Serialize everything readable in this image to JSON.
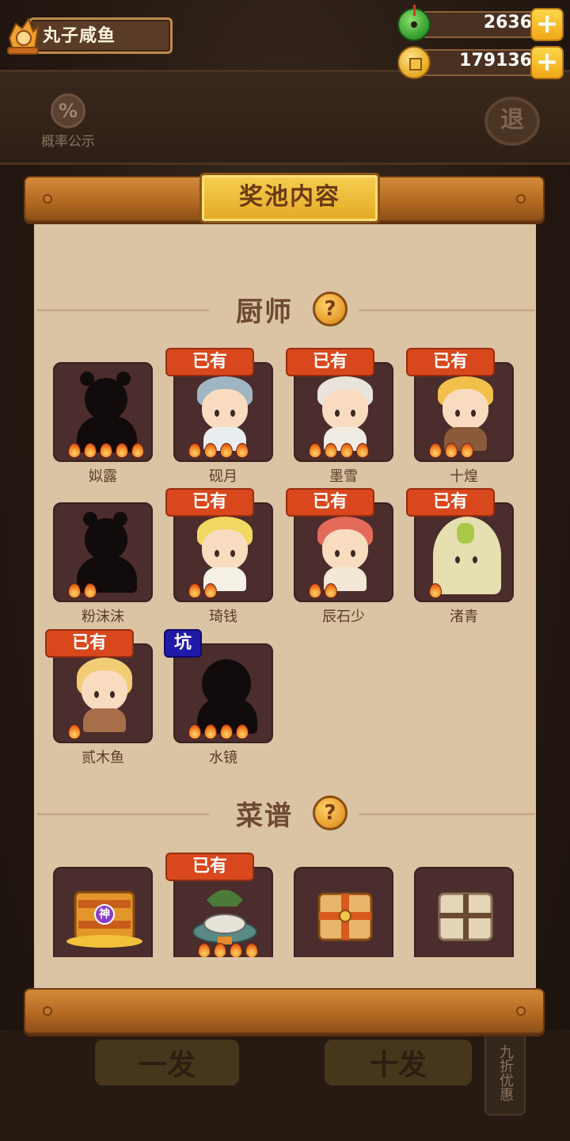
{
  "player": {
    "name": "丸子咸鱼"
  },
  "currencies": [
    {
      "icon": "jade-icon",
      "value": "2636"
    },
    {
      "icon": "coin-icon",
      "value": "179136"
    }
  ],
  "background": {
    "probability_label": "概率公示",
    "probability_symbol": "%",
    "back_label": "退",
    "draw_one_label": "一发",
    "draw_ten_label": "十发",
    "discount_label": "九折优惠"
  },
  "panel": {
    "title": "奖池内容"
  },
  "chef_section": {
    "title": "厨师",
    "help_symbol": "?",
    "owned_label": "已有",
    "pit_label": "坑",
    "chefs": [
      {
        "name": "姒露",
        "owned": false,
        "flames": 5,
        "hidden": true
      },
      {
        "name": "砚月",
        "owned": true,
        "flames": 4
      },
      {
        "name": "墨雪",
        "owned": true,
        "flames": 4
      },
      {
        "name": "十煌",
        "owned": true,
        "flames": 3
      },
      {
        "name": "粉沫沫",
        "owned": false,
        "flames": 2,
        "hidden": true
      },
      {
        "name": "琦钱",
        "owned": true,
        "flames": 2
      },
      {
        "name": "辰石少",
        "owned": true,
        "flames": 2
      },
      {
        "name": "渚青",
        "owned": true,
        "flames": 1
      },
      {
        "name": "贰木鱼",
        "owned": true,
        "flames": 1
      },
      {
        "name": "水镜",
        "owned": false,
        "pit": true,
        "flames": 4,
        "hidden": true
      }
    ]
  },
  "recipe_section": {
    "title": "菜谱",
    "help_symbol": "?",
    "recipes": [
      {
        "owned": false,
        "badge": "神"
      },
      {
        "owned": true
      },
      {
        "owned": false
      },
      {
        "owned": false
      }
    ]
  }
}
